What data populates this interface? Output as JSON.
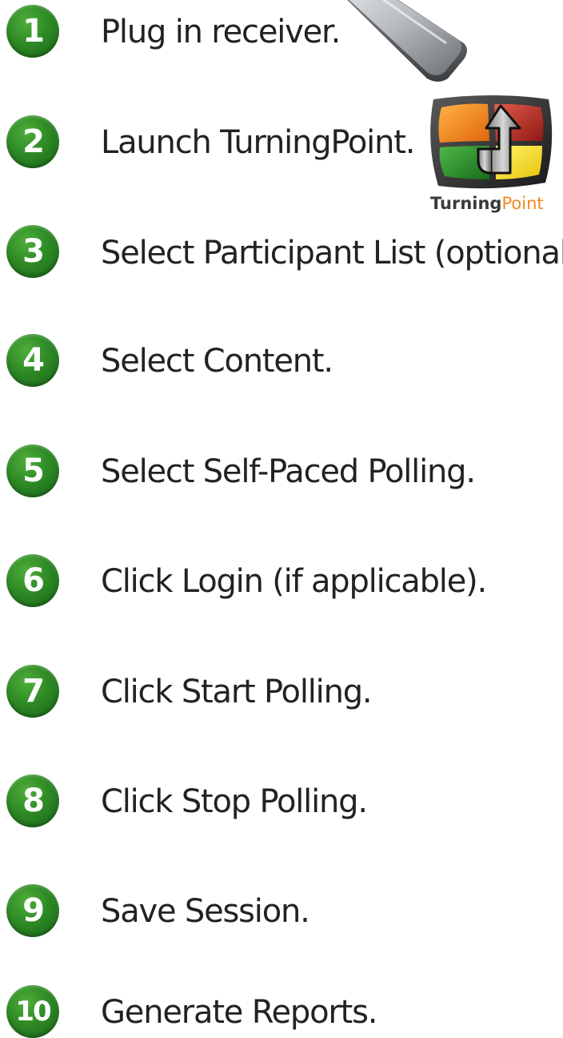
{
  "steps": [
    {
      "number": "1",
      "text": "Plug in receiver."
    },
    {
      "number": "2",
      "text": "Launch TurningPoint."
    },
    {
      "number": "3",
      "text": "Select Participant List (optional)."
    },
    {
      "number": "4",
      "text": "Select Content."
    },
    {
      "number": "5",
      "text": "Select Self-Paced Polling."
    },
    {
      "number": "6",
      "text": "Click Login (if applicable)."
    },
    {
      "number": "7",
      "text": "Click Start Polling."
    },
    {
      "number": "8",
      "text": "Click Stop Polling."
    },
    {
      "number": "9",
      "text": "Save Session."
    },
    {
      "number": "10",
      "text": "Generate Reports."
    }
  ],
  "logo": {
    "word_dark": "Turning",
    "word_accent": "Point"
  },
  "colors": {
    "badge_green": "#2e8a25",
    "text": "#222222",
    "logo_accent": "#f08a1c"
  },
  "icons": {
    "receiver": "usb-receiver-icon",
    "logo": "turningpoint-logo-icon"
  }
}
